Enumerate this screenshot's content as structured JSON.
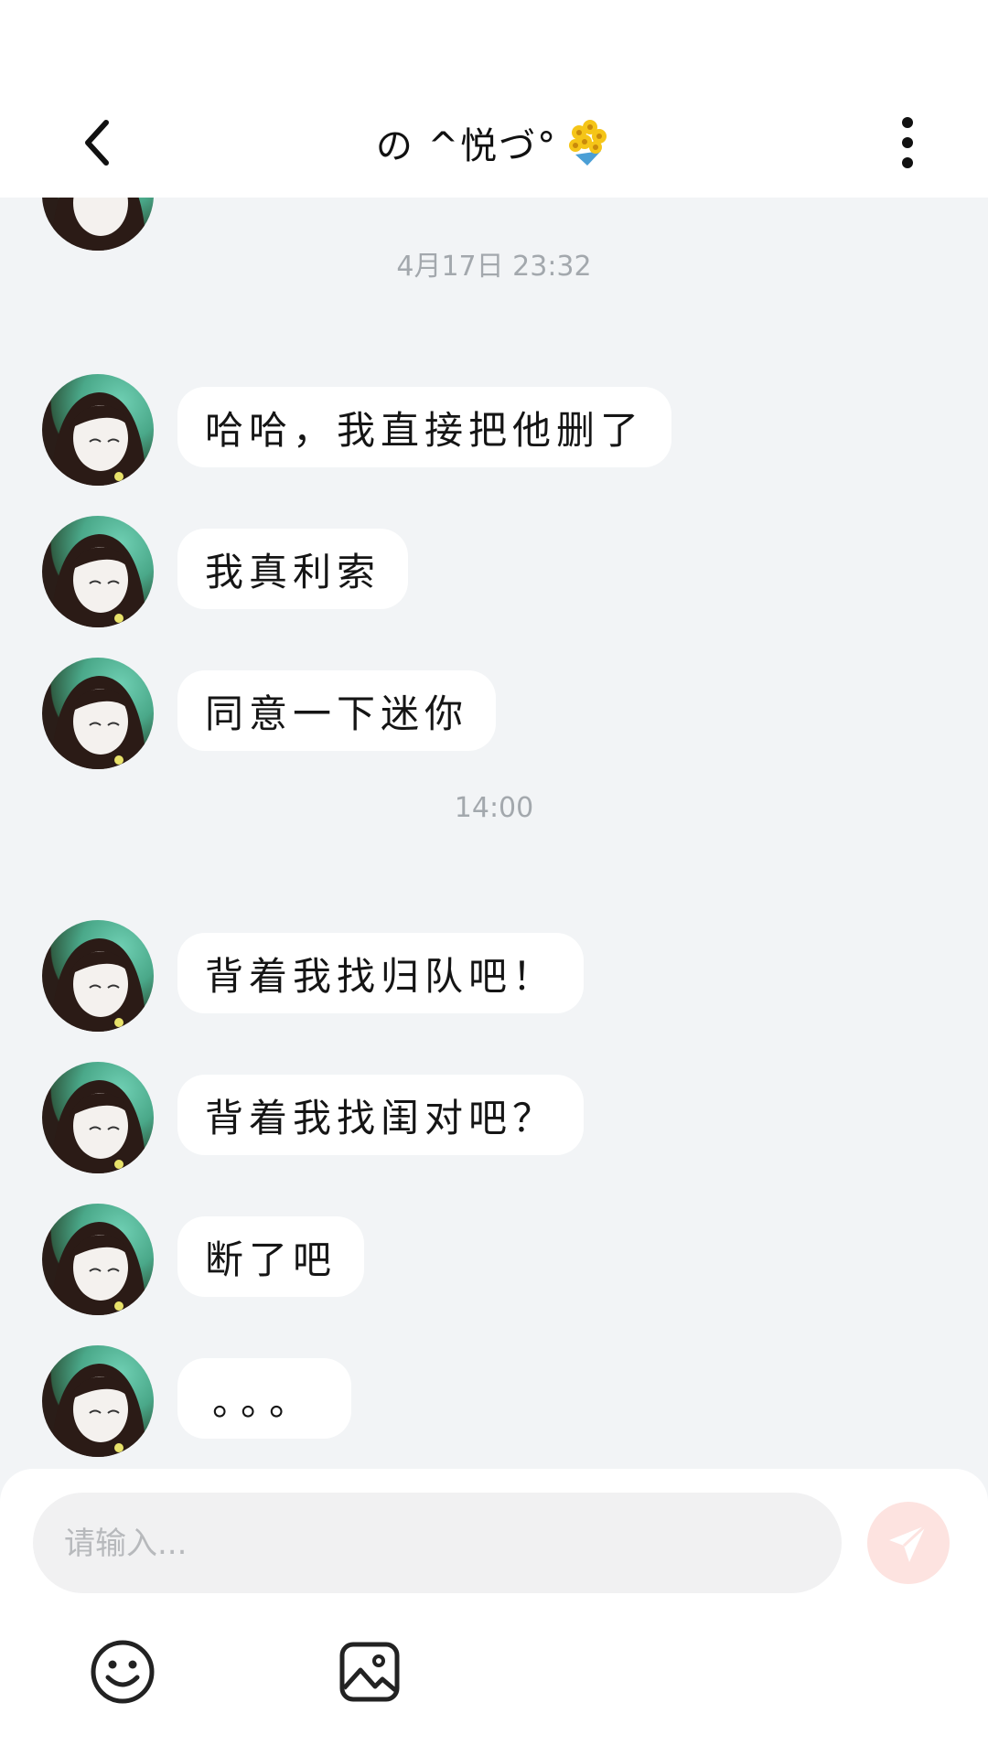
{
  "header": {
    "title": "の ^悦づ°",
    "title_emoji_icon": "flower-bouquet-icon",
    "back_icon": "chevron-left-icon",
    "more_icon": "more-vertical-icon"
  },
  "messages": {
    "ts1": "4月17日 23:32",
    "m1": "哈哈，我直接把他删了",
    "m2": "我真利索",
    "m3": "同意一下迷你",
    "ts2": "14:00",
    "m4": "背着我找归队吧！",
    "m5": "背着我找闺对吧？",
    "m6": "断了吧",
    "m7": "。。。"
  },
  "composer": {
    "placeholder": "请输入...",
    "send_icon": "send-icon",
    "emoji_icon": "smile-icon",
    "image_icon": "image-icon"
  },
  "colors": {
    "background": "#f2f4f6",
    "bubble": "#ffffff",
    "send_button": "#fde3e0",
    "send_icon": "#ffffff",
    "timestamp": "#a3a8ad"
  }
}
